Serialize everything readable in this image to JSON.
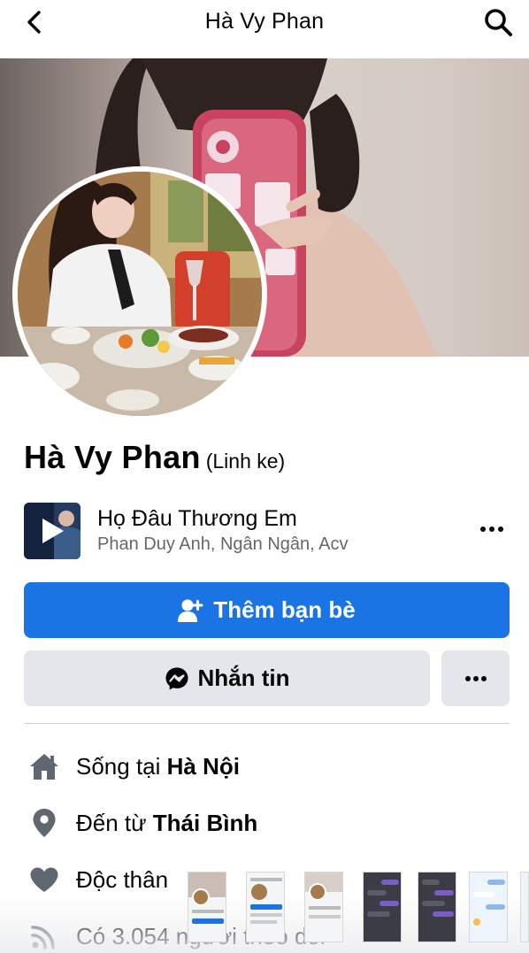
{
  "header": {
    "title": "Hà Vy Phan",
    "back_icon": "chevron-left-icon",
    "search_icon": "search-icon"
  },
  "profile": {
    "name": "Hà Vy Phan",
    "alternate_name": "(Linh ke)"
  },
  "music": {
    "song": "Họ Đâu Thương Em",
    "artists": "Phan Duy Anh, Ngân Ngân, Acv",
    "more_icon": "more-horizontal-icon"
  },
  "actions": {
    "add_friend_label": "Thêm bạn bè",
    "message_label": "Nhắn tin",
    "colors": {
      "primary": "#1b74e4",
      "secondary": "#e4e6eb"
    }
  },
  "details": {
    "lives_prefix": "Sống tại ",
    "lives_place": "Hà Nội",
    "from_prefix": "Đến từ ",
    "from_place": "Thái Bình",
    "relationship": "Độc thân",
    "followers": "Có 3.054 người theo dõi"
  }
}
